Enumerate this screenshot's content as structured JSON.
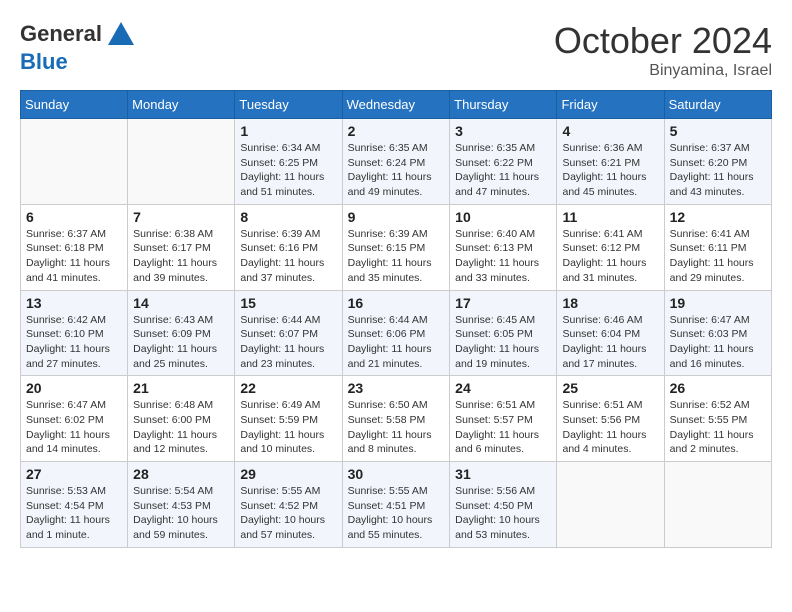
{
  "header": {
    "logo_line1": "General",
    "logo_line2": "Blue",
    "month_year": "October 2024",
    "location": "Binyamina, Israel"
  },
  "weekdays": [
    "Sunday",
    "Monday",
    "Tuesday",
    "Wednesday",
    "Thursday",
    "Friday",
    "Saturday"
  ],
  "weeks": [
    [
      {
        "day": "",
        "info": ""
      },
      {
        "day": "",
        "info": ""
      },
      {
        "day": "1",
        "info": "Sunrise: 6:34 AM\nSunset: 6:25 PM\nDaylight: 11 hours and 51 minutes."
      },
      {
        "day": "2",
        "info": "Sunrise: 6:35 AM\nSunset: 6:24 PM\nDaylight: 11 hours and 49 minutes."
      },
      {
        "day": "3",
        "info": "Sunrise: 6:35 AM\nSunset: 6:22 PM\nDaylight: 11 hours and 47 minutes."
      },
      {
        "day": "4",
        "info": "Sunrise: 6:36 AM\nSunset: 6:21 PM\nDaylight: 11 hours and 45 minutes."
      },
      {
        "day": "5",
        "info": "Sunrise: 6:37 AM\nSunset: 6:20 PM\nDaylight: 11 hours and 43 minutes."
      }
    ],
    [
      {
        "day": "6",
        "info": "Sunrise: 6:37 AM\nSunset: 6:18 PM\nDaylight: 11 hours and 41 minutes."
      },
      {
        "day": "7",
        "info": "Sunrise: 6:38 AM\nSunset: 6:17 PM\nDaylight: 11 hours and 39 minutes."
      },
      {
        "day": "8",
        "info": "Sunrise: 6:39 AM\nSunset: 6:16 PM\nDaylight: 11 hours and 37 minutes."
      },
      {
        "day": "9",
        "info": "Sunrise: 6:39 AM\nSunset: 6:15 PM\nDaylight: 11 hours and 35 minutes."
      },
      {
        "day": "10",
        "info": "Sunrise: 6:40 AM\nSunset: 6:13 PM\nDaylight: 11 hours and 33 minutes."
      },
      {
        "day": "11",
        "info": "Sunrise: 6:41 AM\nSunset: 6:12 PM\nDaylight: 11 hours and 31 minutes."
      },
      {
        "day": "12",
        "info": "Sunrise: 6:41 AM\nSunset: 6:11 PM\nDaylight: 11 hours and 29 minutes."
      }
    ],
    [
      {
        "day": "13",
        "info": "Sunrise: 6:42 AM\nSunset: 6:10 PM\nDaylight: 11 hours and 27 minutes."
      },
      {
        "day": "14",
        "info": "Sunrise: 6:43 AM\nSunset: 6:09 PM\nDaylight: 11 hours and 25 minutes."
      },
      {
        "day": "15",
        "info": "Sunrise: 6:44 AM\nSunset: 6:07 PM\nDaylight: 11 hours and 23 minutes."
      },
      {
        "day": "16",
        "info": "Sunrise: 6:44 AM\nSunset: 6:06 PM\nDaylight: 11 hours and 21 minutes."
      },
      {
        "day": "17",
        "info": "Sunrise: 6:45 AM\nSunset: 6:05 PM\nDaylight: 11 hours and 19 minutes."
      },
      {
        "day": "18",
        "info": "Sunrise: 6:46 AM\nSunset: 6:04 PM\nDaylight: 11 hours and 17 minutes."
      },
      {
        "day": "19",
        "info": "Sunrise: 6:47 AM\nSunset: 6:03 PM\nDaylight: 11 hours and 16 minutes."
      }
    ],
    [
      {
        "day": "20",
        "info": "Sunrise: 6:47 AM\nSunset: 6:02 PM\nDaylight: 11 hours and 14 minutes."
      },
      {
        "day": "21",
        "info": "Sunrise: 6:48 AM\nSunset: 6:00 PM\nDaylight: 11 hours and 12 minutes."
      },
      {
        "day": "22",
        "info": "Sunrise: 6:49 AM\nSunset: 5:59 PM\nDaylight: 11 hours and 10 minutes."
      },
      {
        "day": "23",
        "info": "Sunrise: 6:50 AM\nSunset: 5:58 PM\nDaylight: 11 hours and 8 minutes."
      },
      {
        "day": "24",
        "info": "Sunrise: 6:51 AM\nSunset: 5:57 PM\nDaylight: 11 hours and 6 minutes."
      },
      {
        "day": "25",
        "info": "Sunrise: 6:51 AM\nSunset: 5:56 PM\nDaylight: 11 hours and 4 minutes."
      },
      {
        "day": "26",
        "info": "Sunrise: 6:52 AM\nSunset: 5:55 PM\nDaylight: 11 hours and 2 minutes."
      }
    ],
    [
      {
        "day": "27",
        "info": "Sunrise: 5:53 AM\nSunset: 4:54 PM\nDaylight: 11 hours and 1 minute."
      },
      {
        "day": "28",
        "info": "Sunrise: 5:54 AM\nSunset: 4:53 PM\nDaylight: 10 hours and 59 minutes."
      },
      {
        "day": "29",
        "info": "Sunrise: 5:55 AM\nSunset: 4:52 PM\nDaylight: 10 hours and 57 minutes."
      },
      {
        "day": "30",
        "info": "Sunrise: 5:55 AM\nSunset: 4:51 PM\nDaylight: 10 hours and 55 minutes."
      },
      {
        "day": "31",
        "info": "Sunrise: 5:56 AM\nSunset: 4:50 PM\nDaylight: 10 hours and 53 minutes."
      },
      {
        "day": "",
        "info": ""
      },
      {
        "day": "",
        "info": ""
      }
    ]
  ]
}
